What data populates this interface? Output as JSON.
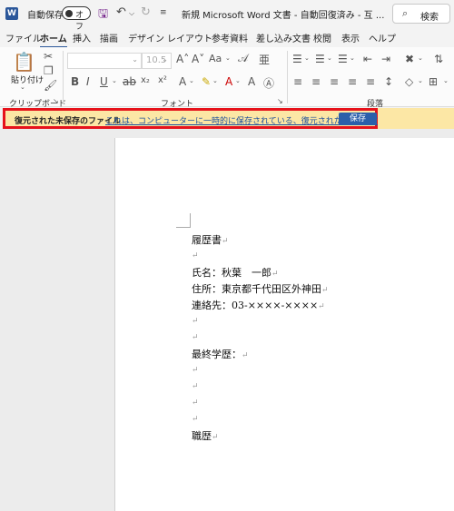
{
  "titlebar": {
    "logo_letter": "W",
    "autosave_label": "自動保存",
    "autosave_state": "オフ",
    "doc_title": "新規 Microsoft Word 文書 - 自動回復済み - 互 ...",
    "search_label": "検索"
  },
  "tabs": [
    "ファイル",
    "ホーム",
    "挿入",
    "描画",
    "デザイン",
    "レイアウト",
    "参考資料",
    "差し込み文書",
    "校閲",
    "表示",
    "ヘルプ"
  ],
  "ribbon": {
    "paste_label": "貼り付け",
    "font_size": "10.5",
    "groups": {
      "clipboard": "クリップボード",
      "font": "フォント",
      "paragraph": "段落"
    }
  },
  "message_bar": {
    "title": "復元された未保存のファイル",
    "text": "これは、コンピューターに一時的に保存されている、復元されたファイルです。",
    "save_button": "保存"
  },
  "document": {
    "pilcrow": "↵",
    "lines": [
      "履歴書",
      "",
      "氏名：秋葉　一郎",
      "住所：東京都千代田区外神田",
      "連絡先：03-××××-××××",
      "",
      "",
      "最終学歴：",
      "",
      "",
      "",
      "",
      "職歴"
    ]
  },
  "colors": {
    "accent": "#2b579a",
    "message_bg": "#fce7a5",
    "highlight_border": "#e6121b"
  }
}
